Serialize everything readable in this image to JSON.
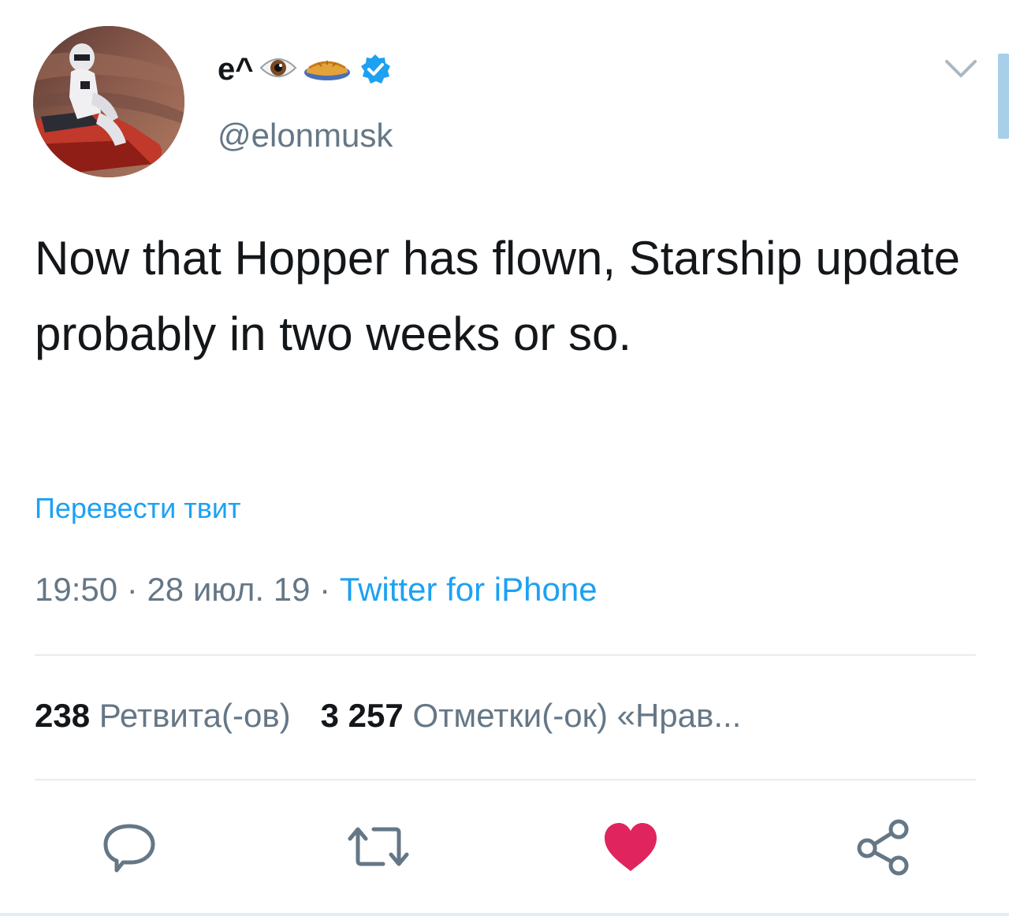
{
  "header": {
    "display_name": "e^",
    "name_emojis": [
      "eye-emoji",
      "pie-emoji"
    ],
    "verified": true,
    "handle": "@elonmusk"
  },
  "tweet": {
    "text": "Now that Hopper has flown, Starship update probably in two weeks or so.",
    "translate_label": "Перевести твит",
    "time": "19:50",
    "date": "28 июл. 19",
    "separator": " · ",
    "source": "Twitter for iPhone"
  },
  "stats": {
    "retweets_count": "238",
    "retweets_label": "Ретвита(-ов)",
    "likes_count": "3 257",
    "likes_label": "Отметки(-ок) «Нрав..."
  },
  "actions": [
    {
      "name": "reply-icon"
    },
    {
      "name": "retweet-icon"
    },
    {
      "name": "like-icon",
      "active": true
    },
    {
      "name": "share-icon"
    }
  ],
  "colors": {
    "text": "#14171a",
    "secondary": "#657786",
    "link": "#1da1f2",
    "like": "#e0245e",
    "divider": "#e6ecf0"
  }
}
